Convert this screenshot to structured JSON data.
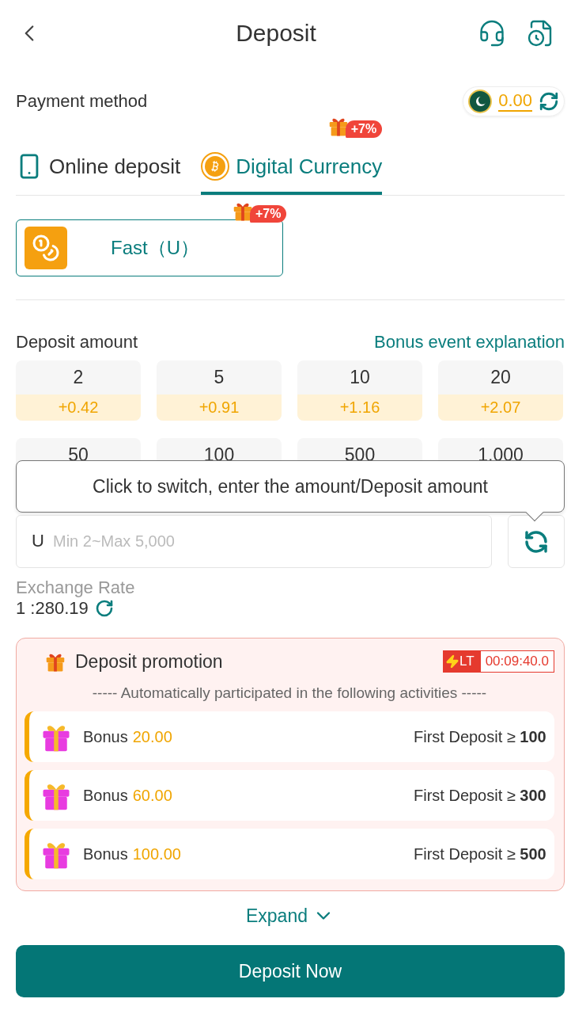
{
  "header": {
    "title": "Deposit"
  },
  "payment": {
    "label": "Payment method",
    "balance": "0.00"
  },
  "tabs": [
    {
      "label": "Online deposit",
      "selected": false,
      "kind": "phone"
    },
    {
      "label": "Digital Currency",
      "selected": true,
      "kind": "coin",
      "badge": "+7%"
    }
  ],
  "channels": [
    {
      "label": "Fast（U）",
      "selected": true,
      "badge": "+7%"
    }
  ],
  "amount": {
    "label": "Deposit amount",
    "link": "Bonus event explanation",
    "options": [
      {
        "value": "2",
        "bonus": "+0.42"
      },
      {
        "value": "5",
        "bonus": "+0.91"
      },
      {
        "value": "10",
        "bonus": "+1.16"
      },
      {
        "value": "20",
        "bonus": "+2.07"
      },
      {
        "value": "50"
      },
      {
        "value": "100"
      },
      {
        "value": "500"
      },
      {
        "value": "1,000"
      }
    ]
  },
  "tooltip": "Click to switch, enter the amount/Deposit amount",
  "input": {
    "prefix": "U",
    "placeholder": "Min 2~Max 5,000"
  },
  "exchange": {
    "label": "Exchange Rate",
    "value": "1 :280.19"
  },
  "promotion": {
    "title": "Deposit promotion",
    "tag": "LT",
    "timer": "00:09:40.0",
    "subtitle": "----- Automatically participated in the following activities -----",
    "items": [
      {
        "label": "Bonus",
        "amount": "20.00",
        "condition": "First Deposit ≥ **100**"
      },
      {
        "label": "Bonus",
        "amount": "60.00",
        "condition": "First Deposit ≥ **300**"
      },
      {
        "label": "Bonus",
        "amount": "100.00",
        "condition": "First Deposit ≥ **500**"
      }
    ]
  },
  "expand": "Expand",
  "submit": "Deposit Now"
}
